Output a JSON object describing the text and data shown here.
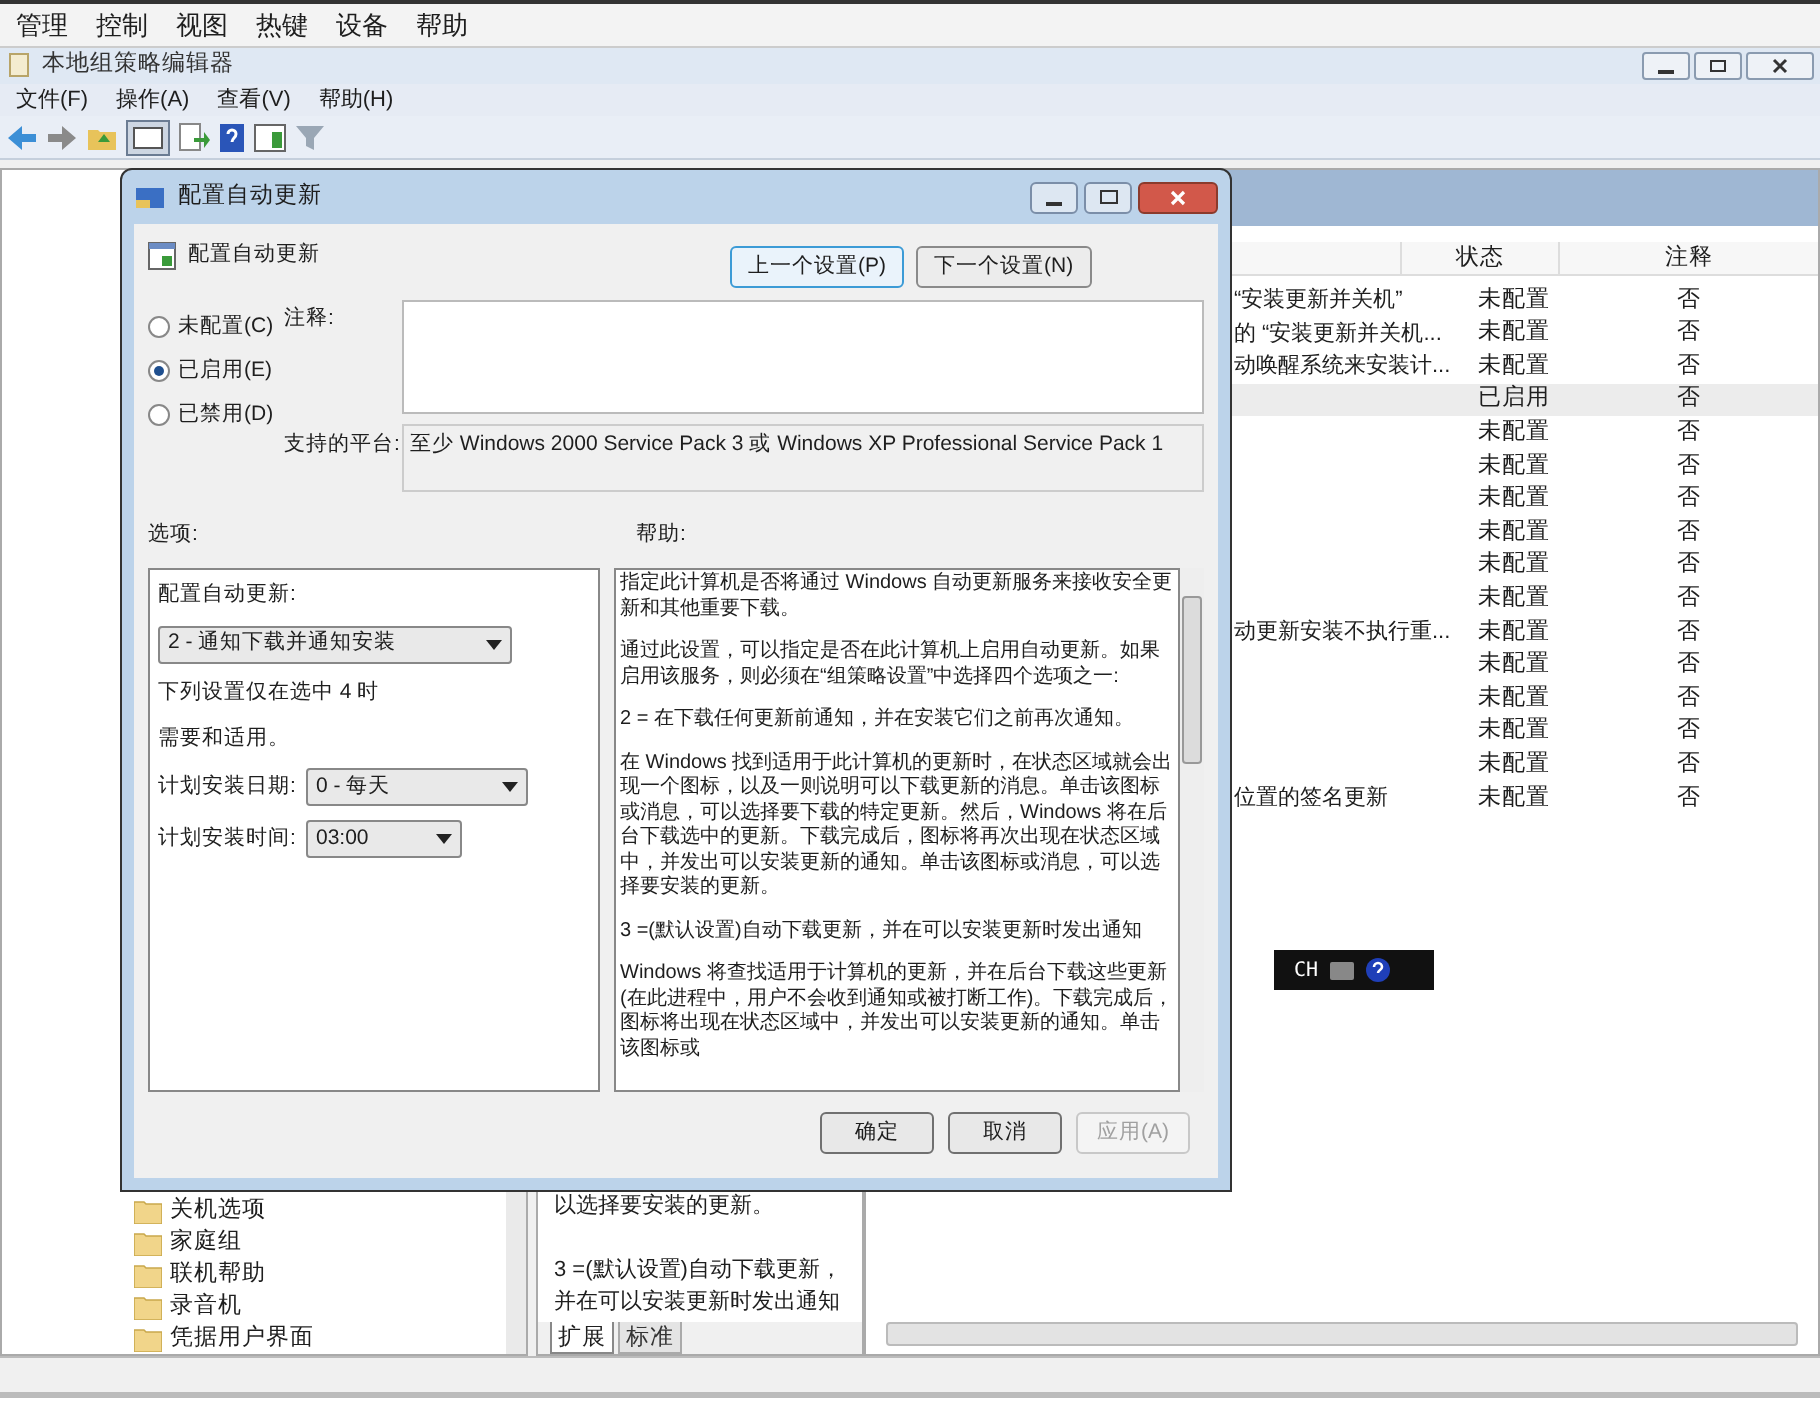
{
  "vm_menu": [
    "管理",
    "控制",
    "视图",
    "热键",
    "设备",
    "帮助"
  ],
  "editor": {
    "title": "本地组策略编辑器",
    "menu": [
      "文件(F)",
      "操作(A)",
      "查看(V)",
      "帮助(H)"
    ],
    "tree_items": [
      "关机选项",
      "家庭组",
      "联机帮助",
      "录音机",
      "凭据用户界面"
    ],
    "help_lines": [
      "以选择要安装的更新。",
      "3 =(默认设置)自动下载更新，并在可以安装更新时发出通知"
    ],
    "pane_tabs": [
      {
        "label": "扩展",
        "selected": true
      },
      {
        "label": "标准",
        "selected": false
      }
    ],
    "table": {
      "columns": [
        "状态",
        "注释"
      ],
      "rows": [
        {
          "name": "“安装更新并关机”",
          "state": "未配置",
          "comment": "否",
          "selected": false
        },
        {
          "name": "的 “安装更新并关机...",
          "state": "未配置",
          "comment": "否",
          "selected": false
        },
        {
          "name": "动唤醒系统来安装计...",
          "state": "未配置",
          "comment": "否",
          "selected": false
        },
        {
          "state": "已启用",
          "comment": "否",
          "selected": true
        },
        {
          "state": "未配置",
          "comment": "否",
          "selected": false
        },
        {
          "state": "未配置",
          "comment": "否",
          "selected": false
        },
        {
          "state": "未配置",
          "comment": "否",
          "selected": false
        },
        {
          "state": "未配置",
          "comment": "否",
          "selected": false
        },
        {
          "state": "未配置",
          "comment": "否",
          "selected": false
        },
        {
          "state": "未配置",
          "comment": "否",
          "selected": false
        },
        {
          "name": "动更新安装不执行重...",
          "state": "未配置",
          "comment": "否",
          "selected": false
        },
        {
          "state": "未配置",
          "comment": "否",
          "selected": false
        },
        {
          "state": "未配置",
          "comment": "否",
          "selected": false
        },
        {
          "state": "未配置",
          "comment": "否",
          "selected": false
        },
        {
          "state": "未配置",
          "comment": "否",
          "selected": false
        },
        {
          "name": "位置的签名更新",
          "state": "未配置",
          "comment": "否",
          "selected": false
        }
      ]
    }
  },
  "language_bar": {
    "label": "CH"
  },
  "dialog": {
    "title": "配置自动更新",
    "heading": "配置自动更新",
    "nav_buttons": [
      "上一个设置(P)",
      "下一个设置(N)"
    ],
    "radios": [
      {
        "label": "未配置(C)",
        "selected": false
      },
      {
        "label": "已启用(E)",
        "selected": true
      },
      {
        "label": "已禁用(D)",
        "selected": false
      }
    ],
    "comment_label": "注释:",
    "platform_label": "支持的平台:",
    "platform": "至少 Windows 2000 Service Pack 3 或 Windows XP Professional Service Pack 1",
    "options_label": "选项:",
    "help_label": "帮助:",
    "options": {
      "mode_label": "配置自动更新:",
      "mode": "2 - 通知下载并通知安装",
      "notes": [
        "下列设置仅在选中 4 时",
        "需要和适用。"
      ],
      "fields": [
        {
          "label": "计划安装日期:",
          "value": "0 - 每天"
        },
        {
          "label": "计划安装时间:",
          "value": "03:00"
        }
      ]
    },
    "help": [
      "指定此计算机是否将通过 Windows 自动更新服务来接收安全更新和其他重要下载。",
      "通过此设置，可以指定是否在此计算机上启用自动更新。如果启用该服务，则必须在“组策略设置”中选择四个选项之一:",
      "2 = 在下载任何更新前通知，并在安装它们之前再次通知。",
      "在 Windows 找到适用于此计算机的更新时，在状态区域就会出现一个图标，以及一则说明可以下载更新的消息。单击该图标或消息，可以选择要下载的特定更新。然后，Windows 将在后台下载选中的更新。下载完成后，图标将再次出现在状态区域中，并发出可以安装更新的通知。单击该图标或消息，可以选择要安装的更新。",
      "3 =(默认设置)自动下载更新，并在可以安装更新时发出通知",
      "Windows 将查找适用于计算机的更新，并在后台下载这些更新(在此进程中，用户不会收到通知或被打断工作)。下载完成后，图标将出现在状态区域中，并发出可以安装更新的通知。单击该图标或"
    ],
    "buttons": [
      {
        "label": "确定",
        "disabled": false
      },
      {
        "label": "取消",
        "disabled": false
      },
      {
        "label": "应用(A)",
        "disabled": true
      }
    ]
  }
}
